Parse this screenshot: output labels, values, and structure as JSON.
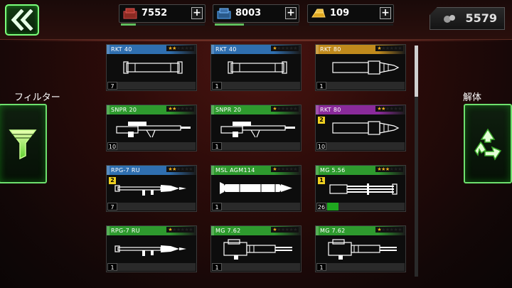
{
  "resources": [
    {
      "value": "7552",
      "icon": "red-crate-icon",
      "bar": 0.18
    },
    {
      "value": "8003",
      "icon": "blue-crate-icon",
      "bar": 0.35
    },
    {
      "value": "109",
      "icon": "gold-bars-icon",
      "bar": 0.0
    }
  ],
  "plus_label": "+",
  "premium": {
    "value": "5579",
    "icon": "bolts-icon"
  },
  "filter_label": "フィルター",
  "dismantle_label": "解体",
  "rarity_colors": {
    "blue": "#2f6fb0",
    "gold": "#c08a1c",
    "green": "#2e9a2e",
    "purple": "#8a2a9a"
  },
  "cards": [
    {
      "name": "RKT 40",
      "rarity": "blue",
      "stars": 2,
      "count": "7",
      "level": "",
      "progress": 0,
      "weapon": "rocket-tube"
    },
    {
      "name": "RKT 40",
      "rarity": "blue",
      "stars": 1,
      "count": "1",
      "level": "",
      "progress": 0,
      "weapon": "rocket-tube"
    },
    {
      "name": "RKT 80",
      "rarity": "gold",
      "stars": 1,
      "count": "1",
      "level": "",
      "progress": 0,
      "weapon": "rocket-launcher"
    },
    {
      "name": "SNPR 20",
      "rarity": "green",
      "stars": 2,
      "count": "10",
      "level": "",
      "progress": 0,
      "weapon": "sniper"
    },
    {
      "name": "SNPR 20",
      "rarity": "green",
      "stars": 1,
      "count": "1",
      "level": "",
      "progress": 0,
      "weapon": "sniper"
    },
    {
      "name": "RKT 80",
      "rarity": "purple",
      "stars": 2,
      "count": "10",
      "level": "2",
      "progress": 0,
      "weapon": "rocket-launcher"
    },
    {
      "name": "RPG-7 RU",
      "rarity": "blue",
      "stars": 2,
      "count": "7",
      "level": "2",
      "progress": 0,
      "weapon": "rpg"
    },
    {
      "name": "MSL AGM114",
      "rarity": "green",
      "stars": 1,
      "count": "1",
      "level": "",
      "progress": 0,
      "weapon": "missile"
    },
    {
      "name": "MG 5.56",
      "rarity": "green",
      "stars": 3,
      "count": "26",
      "level": "1",
      "progress": 0.13,
      "weapon": "minigun"
    },
    {
      "name": "RPG-7 RU",
      "rarity": "green",
      "stars": 1,
      "count": "1",
      "level": "",
      "progress": 0,
      "weapon": "rpg"
    },
    {
      "name": "MG 7.62",
      "rarity": "green",
      "stars": 1,
      "count": "1",
      "level": "",
      "progress": 0,
      "weapon": "heavy-mg"
    },
    {
      "name": "MG 7.62",
      "rarity": "green",
      "stars": 1,
      "count": "1",
      "level": "",
      "progress": 0,
      "weapon": "heavy-mg"
    }
  ]
}
